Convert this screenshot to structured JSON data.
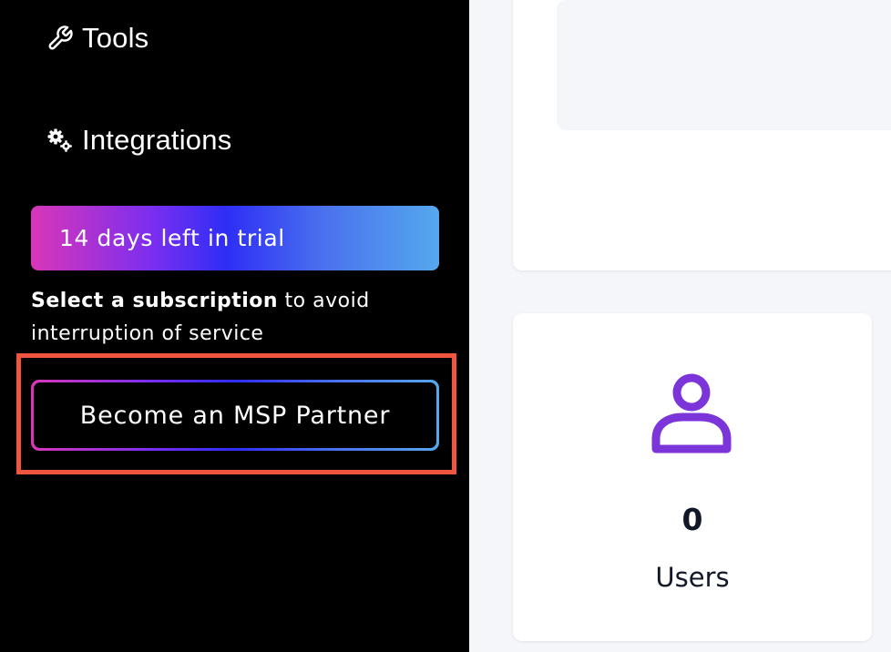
{
  "sidebar": {
    "nav_items": [
      {
        "label": "Tools",
        "icon": "wrench-icon"
      },
      {
        "label": "Integrations",
        "icon": "gears-icon"
      }
    ],
    "trial_banner": {
      "text": "14 days left in trial",
      "gradient_colors": [
        "#d936b8",
        "#2e2ef5",
        "#55a8ee"
      ]
    },
    "subscription_notice": {
      "bold_text": "Select a subscription",
      "rest_text": " to avoid interruption of service"
    },
    "msp_button": {
      "label": "Become an MSP Partner"
    },
    "highlight_color": "#f0553f"
  },
  "main": {
    "users_card": {
      "icon": "user-icon",
      "count": "0",
      "label": "Users",
      "icon_color": "#7b35d8"
    }
  }
}
